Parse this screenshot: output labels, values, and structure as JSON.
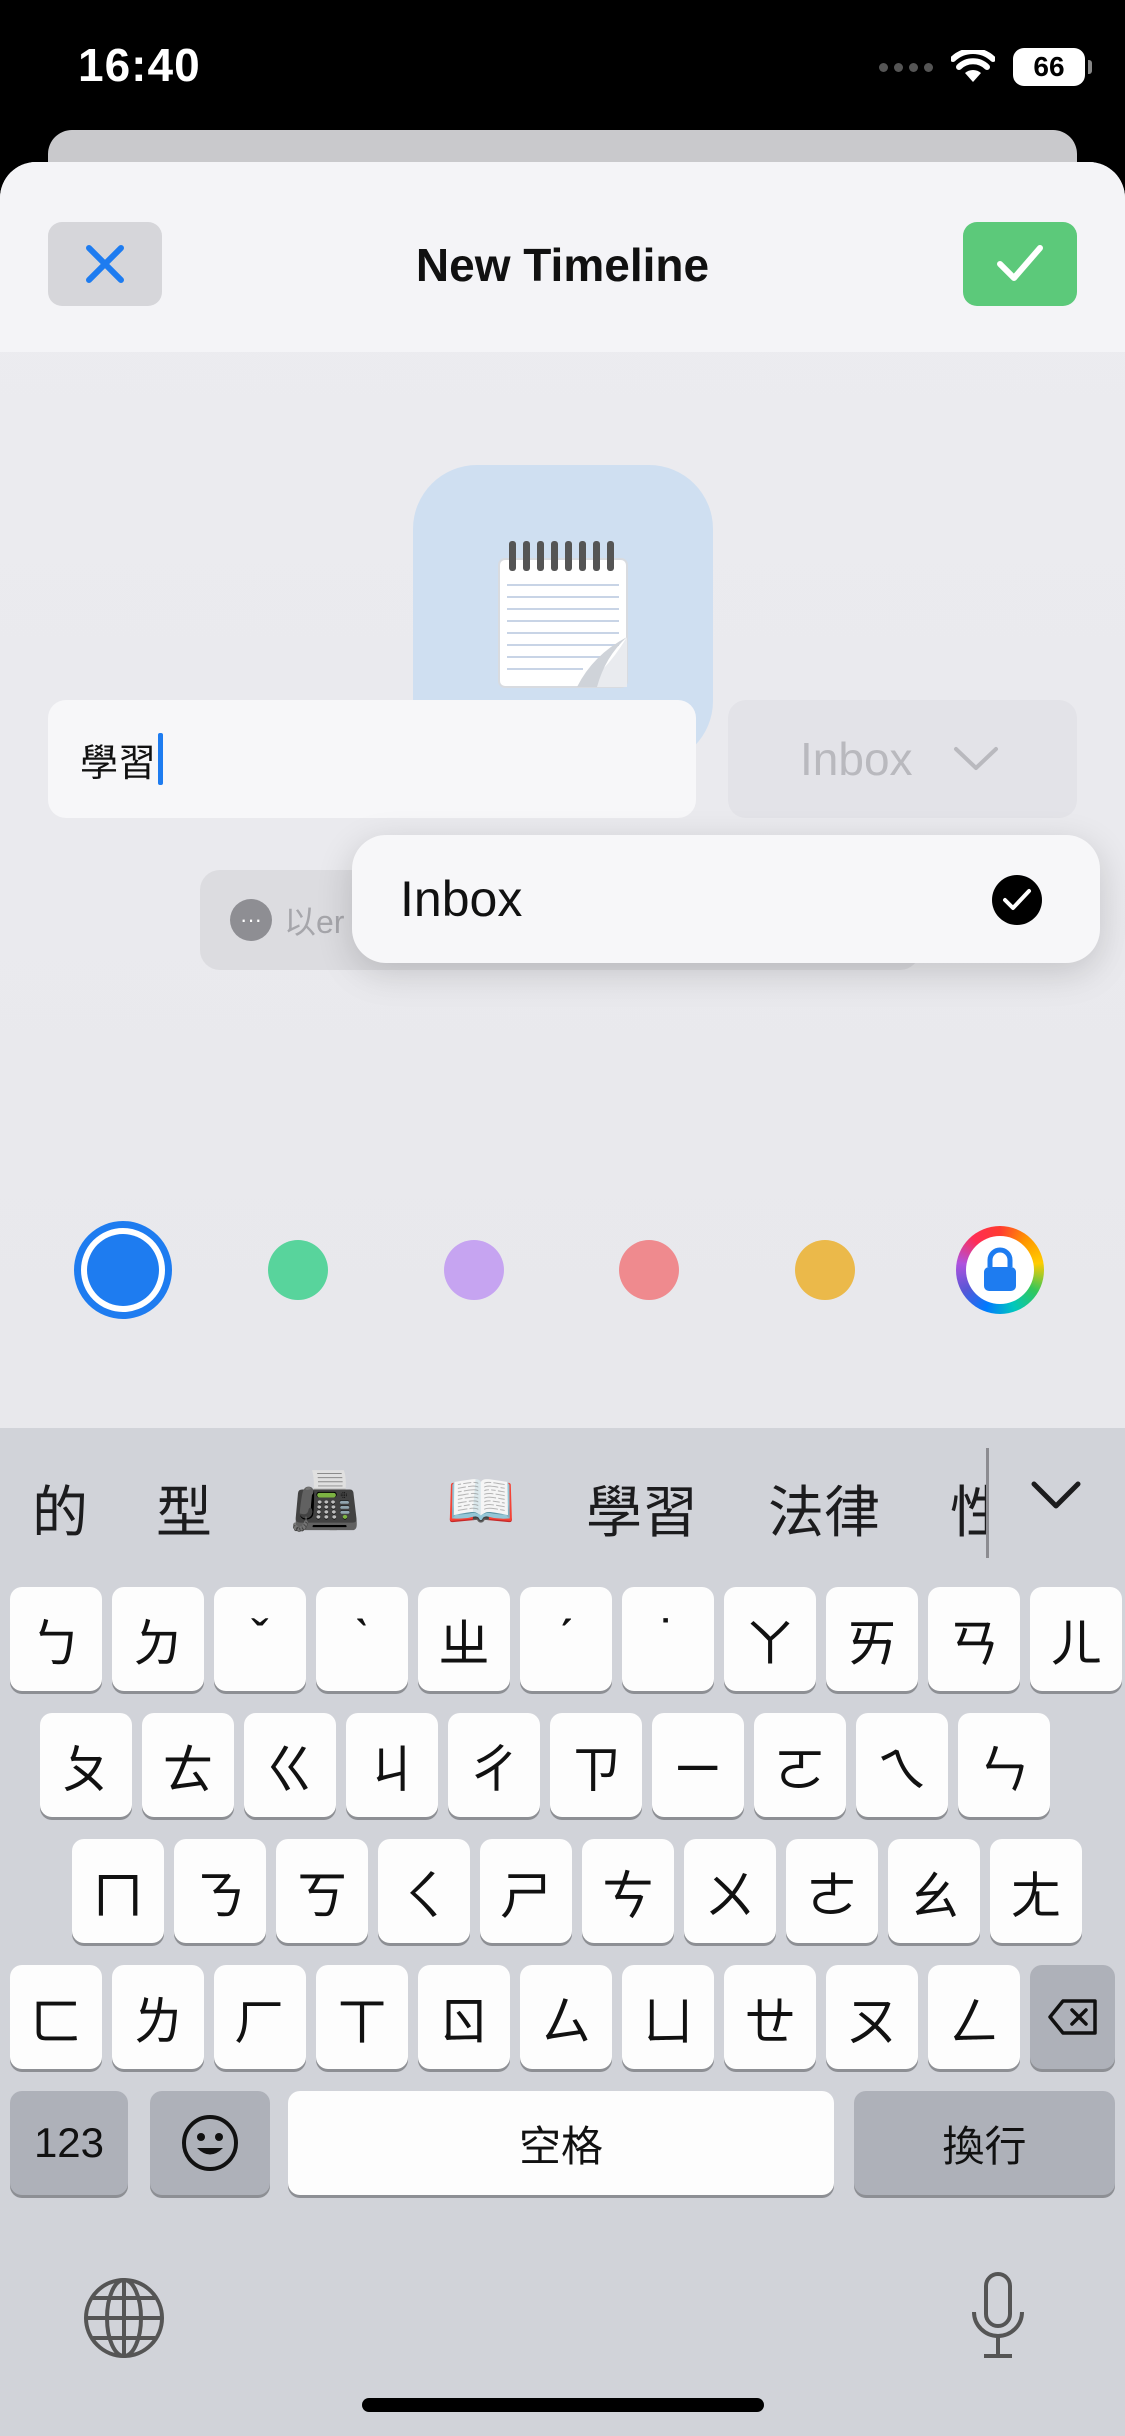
{
  "status_bar": {
    "time": "16:40",
    "battery": "66"
  },
  "sheet": {
    "title": "New Timeline",
    "close_icon": "close-icon",
    "confirm_icon": "checkmark-icon"
  },
  "icon_tile": {
    "icon": "notepad-icon"
  },
  "name_field": {
    "value": "學習"
  },
  "category_select": {
    "value": "Inbox"
  },
  "hint": {
    "text": "以er"
  },
  "dropdown": {
    "items": [
      {
        "label": "Inbox",
        "selected": true
      }
    ]
  },
  "colors": {
    "swatches": [
      "#1e7cf0",
      "#58d49c",
      "#c6a4f1",
      "#ef8a8e",
      "#ebb94a"
    ],
    "selected_index": 0,
    "lock_icon": "lock-icon"
  },
  "keyboard": {
    "candidates": [
      "的",
      "型",
      "📠",
      "📖",
      "學習",
      "法律",
      "性"
    ],
    "rows": [
      [
        "ㄅ",
        "ㄉ",
        "ˇ",
        "ˋ",
        "ㄓ",
        "ˊ",
        "˙",
        "ㄚ",
        "ㄞ",
        "ㄢ",
        "ㄦ"
      ],
      [
        "ㄆ",
        "ㄊ",
        "ㄍ",
        "ㄐ",
        "ㄔ",
        "ㄗ",
        "ㄧ",
        "ㄛ",
        "ㄟ",
        "ㄣ"
      ],
      [
        "ㄇ",
        "ㄋ",
        "ㄎ",
        "ㄑ",
        "ㄕ",
        "ㄘ",
        "ㄨ",
        "ㄜ",
        "ㄠ",
        "ㄤ"
      ],
      [
        "ㄈ",
        "ㄌ",
        "ㄏ",
        "ㄒ",
        "ㄖ",
        "ㄙ",
        "ㄩ",
        "ㄝ",
        "ㄡ",
        "ㄥ"
      ]
    ],
    "numbers_label": "123",
    "space_label": "空格",
    "return_label": "換行"
  }
}
